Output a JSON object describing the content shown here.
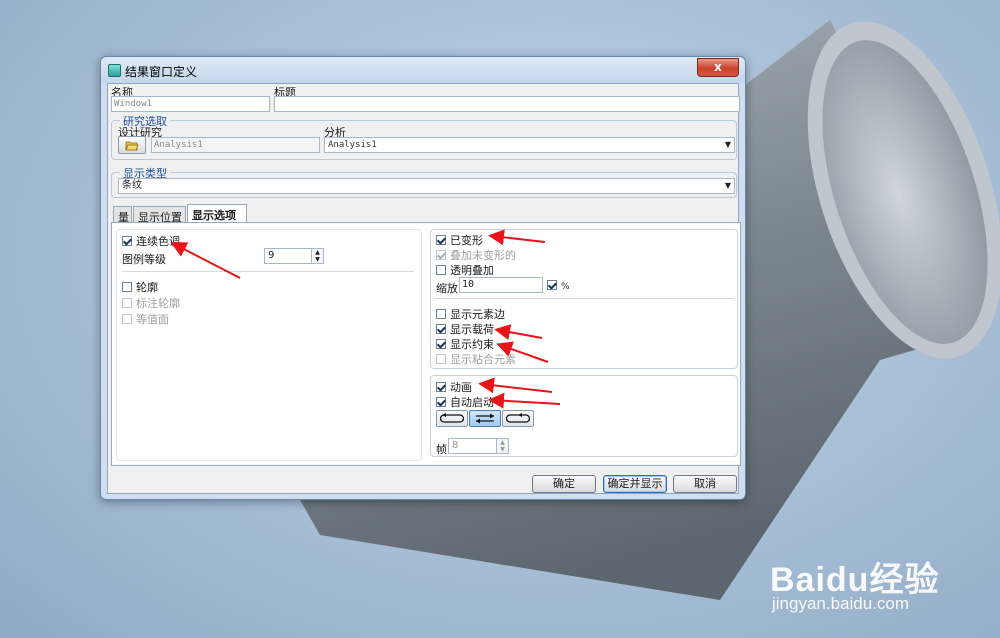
{
  "window": {
    "title": "结果窗口定义",
    "close_label": "x"
  },
  "top_fields": {
    "name_label": "名称",
    "name_value": "Window1",
    "title_label": "标题",
    "title_value": ""
  },
  "study_group": {
    "title": "研究选取",
    "design_study_label": "设计研究",
    "design_study_value": "Analysis1",
    "analysis_label": "分析",
    "analysis_value": "Analysis1"
  },
  "display_type_group": {
    "title": "显示类型",
    "value": "条纹"
  },
  "tabs": [
    {
      "label": "量",
      "active": false
    },
    {
      "label": "显示位置",
      "active": false
    },
    {
      "label": "显示选项",
      "active": true
    }
  ],
  "left_panel": {
    "continuous_tone": {
      "label": "连续色调",
      "checked": true
    },
    "legend_levels_label": "图例等级",
    "legend_levels_value": "9",
    "contour": {
      "label": "轮廓",
      "checked": false
    },
    "label_contour": {
      "label": "标注轮廓",
      "checked": false,
      "disabled": true
    },
    "isosurface": {
      "label": "等值面",
      "checked": false,
      "disabled": true
    }
  },
  "right_panel": {
    "deformed": {
      "label": "已变形",
      "checked": true
    },
    "overlay_undeformed": {
      "label": "叠加未变形的",
      "checked": true,
      "disabled": true
    },
    "transparent_overlay": {
      "label": "透明叠加",
      "checked": false
    },
    "scale_label": "缩放",
    "scale_value": "10",
    "scale_percent_checked": true,
    "percent_label": "%",
    "show_element_edges": {
      "label": "显示元素边",
      "checked": false
    },
    "show_loads": {
      "label": "显示载荷",
      "checked": true
    },
    "show_constraints": {
      "label": "显示约束",
      "checked": true
    },
    "show_bonded": {
      "label": "显示粘合元素",
      "checked": false,
      "disabled": true
    },
    "animation": {
      "label": "动画",
      "checked": true
    },
    "auto_start": {
      "label": "自动启动",
      "checked": true
    },
    "frames_label": "帧",
    "frames_value": "8"
  },
  "buttons": {
    "ok": "确定",
    "ok_show": "确定并显示",
    "cancel": "取消"
  },
  "watermark": {
    "brand": "Baidu经验",
    "url": "jingyan.baidu.com"
  },
  "colors": {
    "arrow": "#e8141a",
    "group_title": "#1e4f9c"
  }
}
